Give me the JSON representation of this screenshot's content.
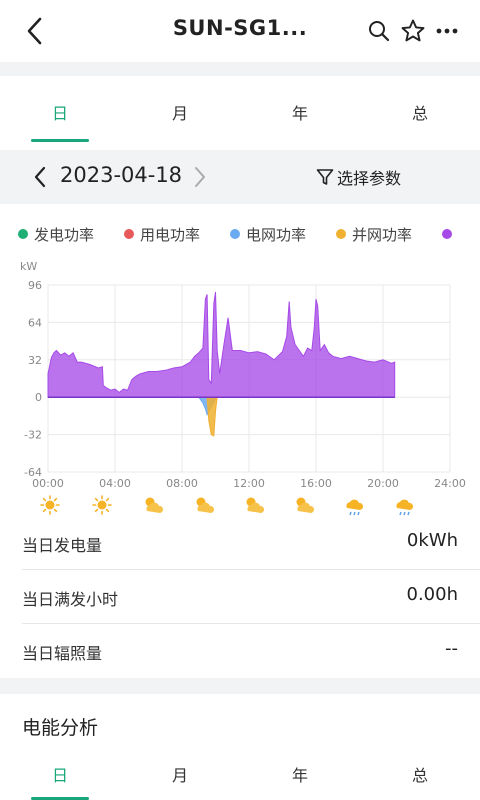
{
  "header": {
    "title": "SUN-SG1...",
    "icons": [
      "back-icon",
      "search-icon",
      "star-icon",
      "more-icon"
    ]
  },
  "period_tabs": [
    {
      "label": "日",
      "active": true
    },
    {
      "label": "月",
      "active": false
    },
    {
      "label": "年",
      "active": false
    },
    {
      "label": "总",
      "active": false
    }
  ],
  "date_bar": {
    "date": "2023-04-18",
    "param_label": "选择参数"
  },
  "legend": [
    {
      "label": "发电功率",
      "color": "#1fae74"
    },
    {
      "label": "用电功率",
      "color": "#e85a5a"
    },
    {
      "label": "电网功率",
      "color": "#6aaaf0"
    },
    {
      "label": "并网功率",
      "color": "#f0b030"
    },
    {
      "label": "",
      "color": "#a64ae8"
    }
  ],
  "chart_data": {
    "type": "area",
    "unit": "kW",
    "ylim": [
      -64,
      96
    ],
    "yticks": [
      "96",
      "64",
      "32",
      "0",
      "-32",
      "-64"
    ],
    "xticks": [
      "00:00",
      "04:00",
      "08:00",
      "12:00",
      "16:00",
      "20:00",
      "24:00"
    ],
    "grid": true,
    "series": [
      {
        "color": "#a64ae8",
        "x": [
          0,
          0.2,
          0.35,
          0.5,
          0.75,
          1.0,
          1.25,
          1.5,
          1.75,
          2.0,
          2.5,
          3.0,
          3.25,
          3.3,
          3.5,
          3.75,
          4.0,
          4.25,
          4.5,
          4.75,
          5.0,
          5.25,
          5.5,
          6.0,
          6.5,
          7.0,
          7.5,
          8.0,
          8.25,
          8.5,
          8.75,
          9.0,
          9.25,
          9.4,
          9.5,
          9.6,
          9.75,
          9.9,
          10.0,
          10.1,
          10.25,
          10.5,
          10.75,
          11.0,
          11.5,
          12.0,
          12.5,
          13.0,
          13.5,
          14.0,
          14.25,
          14.4,
          14.5,
          14.75,
          15.0,
          15.25,
          15.5,
          15.75,
          15.9,
          16.0,
          16.1,
          16.25,
          16.5,
          16.75,
          17.0,
          17.5,
          18.0,
          18.5,
          19.0,
          19.5,
          20.0,
          20.5,
          20.7
        ],
        "values": [
          20,
          34,
          38,
          40,
          36,
          38,
          35,
          38,
          30,
          30,
          28,
          25,
          26,
          10,
          8,
          6,
          7,
          4,
          7,
          6,
          15,
          18,
          20,
          22,
          22,
          23,
          25,
          26,
          28,
          30,
          35,
          38,
          42,
          84,
          88,
          15,
          12,
          80,
          90,
          40,
          20,
          45,
          68,
          40,
          40,
          38,
          39,
          37,
          32,
          39,
          52,
          82,
          60,
          45,
          40,
          35,
          42,
          40,
          60,
          84,
          78,
          40,
          45,
          38,
          35,
          33,
          35,
          33,
          31,
          30,
          32,
          29,
          30
        ]
      },
      {
        "color": "#f0b030",
        "x": [
          9.5,
          9.6,
          9.75,
          9.9,
          10.0,
          10.1
        ],
        "values": [
          0,
          -20,
          -32,
          -33,
          -12,
          0
        ]
      },
      {
        "color": "#6aaaf0",
        "x": [
          9.0,
          9.25,
          9.4,
          9.5,
          9.75,
          9.9,
          10.0
        ],
        "values": [
          0,
          -5,
          -10,
          -15,
          -8,
          -5,
          0
        ]
      }
    ]
  },
  "weather": [
    "sunny-icon",
    "sunny-icon",
    "partly-cloudy-icon",
    "partly-cloudy-icon",
    "partly-cloudy-icon",
    "partly-cloudy-icon",
    "rainy-icon",
    "rainy-icon"
  ],
  "stats": [
    {
      "label": "当日发电量",
      "value": "0kWh"
    },
    {
      "label": "当日满发小时",
      "value": "0.00h"
    },
    {
      "label": "当日辐照量",
      "value": "--"
    }
  ],
  "energy_section": {
    "title": "电能分析",
    "tabs": [
      {
        "label": "日",
        "active": true
      },
      {
        "label": "月",
        "active": false
      },
      {
        "label": "年",
        "active": false
      },
      {
        "label": "总",
        "active": false
      }
    ]
  }
}
